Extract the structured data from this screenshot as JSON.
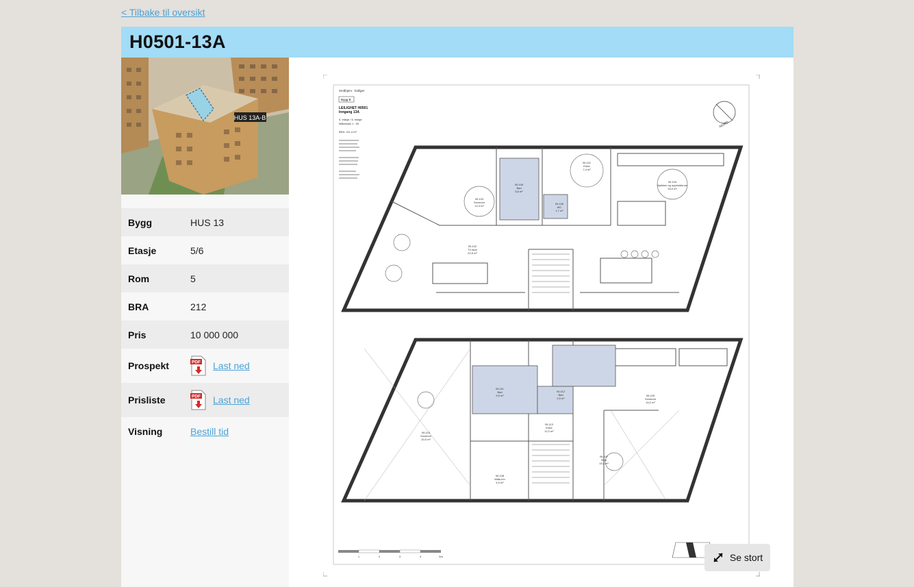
{
  "nav": {
    "back_label": "< Tilbake til oversikt"
  },
  "unit": {
    "title": "H0501-13A",
    "building_tag": "HUS 13A-B"
  },
  "details": [
    {
      "label": "Bygg",
      "value": "HUS 13"
    },
    {
      "label": "Etasje",
      "value": "5/6"
    },
    {
      "label": "Rom",
      "value": "5"
    },
    {
      "label": "BRA",
      "value": "212"
    },
    {
      "label": "Pris",
      "value": "10 000 000"
    }
  ],
  "documents": {
    "prospekt": {
      "label": "Prospekt",
      "link": "Last ned",
      "icon": "pdf-icon"
    },
    "prisliste": {
      "label": "Prisliste",
      "link": "Last ned",
      "icon": "pdf-icon"
    }
  },
  "viewing": {
    "label": "Visning",
    "link": "Bestill tid"
  },
  "floorplan": {
    "header_small": "Småhjem - bolliger",
    "bygg_tag": "Bygg B",
    "apartment": "LEILIGHET H0501",
    "entrance": "Inngang 13A",
    "floors_line": "5. etasje / 6. etasje",
    "scale_line": "Målestokk 1 : 50",
    "bra_line": "BRA: 211,4 m²",
    "upper_rooms": [
      {
        "id": "05.103",
        "name": "Soverom",
        "area": "12,3 m²"
      },
      {
        "id": "05.105",
        "name": "Bad",
        "area": "5,8 m²"
      },
      {
        "id": "05.106",
        "name": "WC",
        "area": "1,7 m²"
      },
      {
        "id": "05.101",
        "name": "Entre",
        "area": "7,4 m²"
      },
      {
        "id": "05.104",
        "name": "Kjøkken og oppholdsrom",
        "area": "33,0 m²"
      },
      {
        "id": "05.102",
        "name": "TV-stue",
        "area": "22,5 m²"
      }
    ],
    "lower_rooms": [
      {
        "id": "06.111",
        "name": "Bad",
        "area": "9,5 m²"
      },
      {
        "id": "06.112",
        "name": "Bad",
        "area": "2,5 m²"
      },
      {
        "id": "06.110",
        "name": "Soverom",
        "area": "20,0 m²"
      },
      {
        "id": "06.113",
        "name": "Entre",
        "area": "11,0 m²"
      },
      {
        "id": "06.109",
        "name": "Soverom",
        "area": "16,2 m²"
      },
      {
        "id": "06.107",
        "name": "Stue",
        "area": "15,3 m²"
      },
      {
        "id": "06.108",
        "name": "Walk-inn",
        "area": "4,9 m²"
      }
    ],
    "scale_ticks": [
      "1",
      "2",
      "3",
      "4",
      "5m"
    ],
    "north": "NORD"
  },
  "actions": {
    "enlarge_label": "Se stort",
    "enlarge_icon": "expand-icon"
  }
}
